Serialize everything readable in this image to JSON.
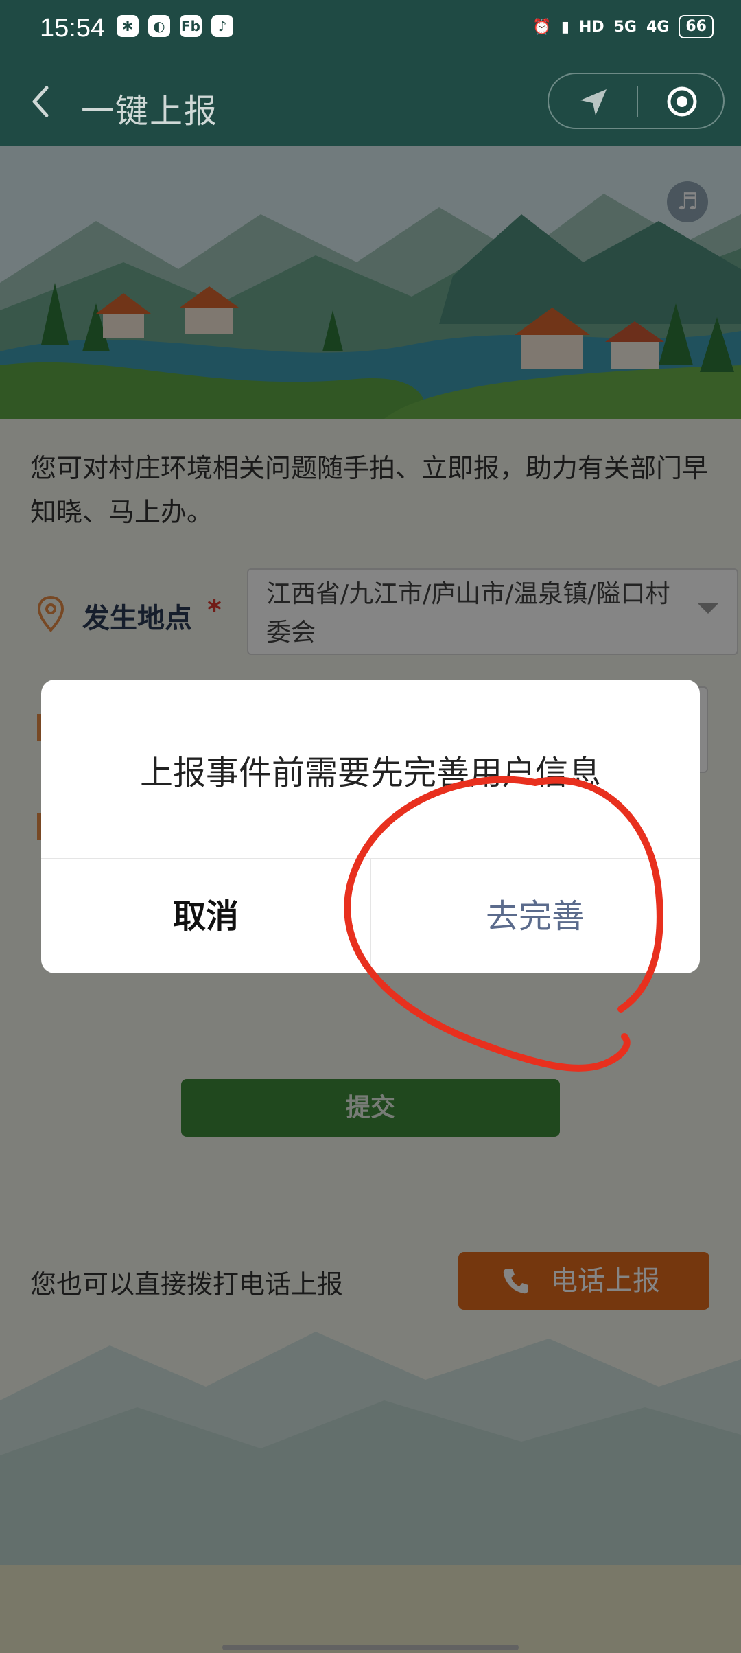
{
  "status_bar": {
    "time": "15:54",
    "app_icons": [
      "wechat-icon",
      "browser-icon",
      "fb-icon",
      "tiktok-icon"
    ],
    "app_icon_glyphs": [
      "✱",
      "◐",
      "Fb",
      "♪"
    ],
    "hd_label": "HD",
    "net1": "5G",
    "net2": "4G",
    "battery": "66"
  },
  "nav": {
    "title": "一键上报"
  },
  "page": {
    "intro": "您可对村庄环境相关问题随手拍、立即报，助力有关部门早知晓、马上办。",
    "location_label": "发生地点",
    "required_mark": "*",
    "location_value": "江西省/九江市/庐山市/温泉镇/隘口村委会",
    "submit_label": "提交",
    "phone_hint": "您也可以直接拨打电话上报",
    "phone_button_label": "电话上报"
  },
  "dialog": {
    "message": "上报事件前需要先完善用户信息",
    "cancel_label": "取消",
    "confirm_label": "去完善"
  },
  "colors": {
    "header": "#1f4a44",
    "submit": "#3f8a3a",
    "phone": "#e06a1c",
    "annotation": "#e8301e"
  }
}
